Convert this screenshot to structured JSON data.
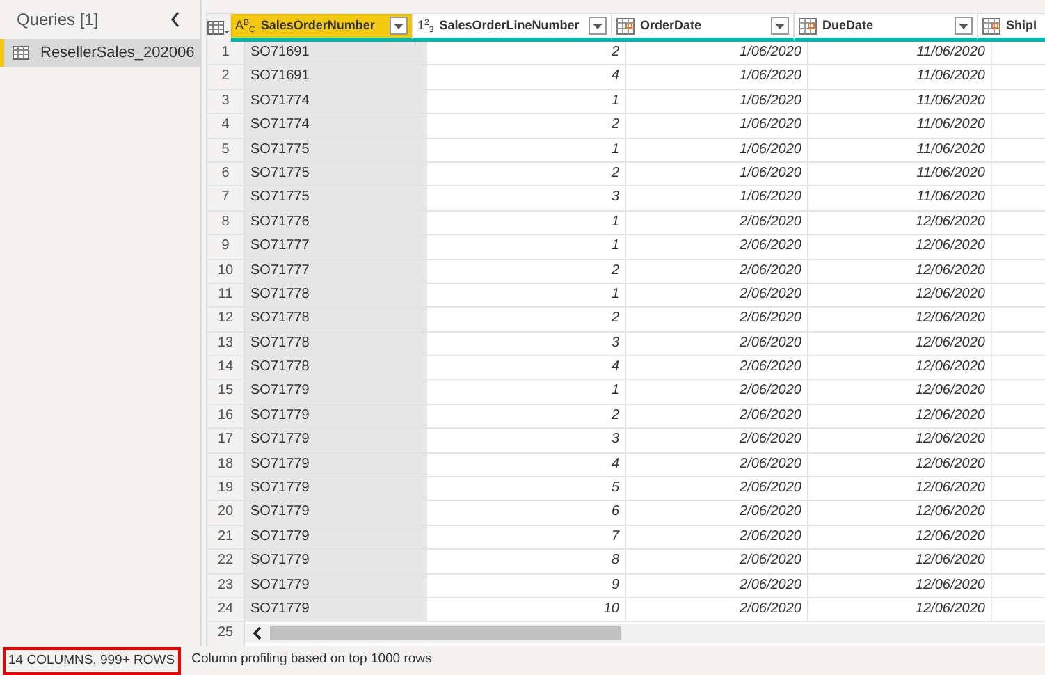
{
  "queries_pane": {
    "title": "Queries [1]",
    "items": [
      {
        "label": "ResellerSales_202006",
        "selected": true
      }
    ]
  },
  "table": {
    "columns": [
      {
        "label": "SalesOrderNumber",
        "kind": "text",
        "type_label": "A$^{B}$$_{C}$",
        "selected": true
      },
      {
        "label": "SalesOrderLineNumber",
        "kind": "number",
        "type_label": "1$^{2}$$_{3}$",
        "selected": false
      },
      {
        "label": "OrderDate",
        "kind": "date",
        "selected": false
      },
      {
        "label": "DueDate",
        "kind": "date",
        "selected": false
      },
      {
        "label": "ShipI",
        "kind": "date",
        "selected": false
      }
    ],
    "rows": [
      {
        "number": "1",
        "cells": [
          "SO71691",
          "2",
          "1/06/2020",
          "11/06/2020"
        ]
      },
      {
        "number": "2",
        "cells": [
          "SO71691",
          "4",
          "1/06/2020",
          "11/06/2020"
        ]
      },
      {
        "number": "3",
        "cells": [
          "SO71774",
          "1",
          "1/06/2020",
          "11/06/2020"
        ]
      },
      {
        "number": "4",
        "cells": [
          "SO71774",
          "2",
          "1/06/2020",
          "11/06/2020"
        ]
      },
      {
        "number": "5",
        "cells": [
          "SO71775",
          "1",
          "1/06/2020",
          "11/06/2020"
        ]
      },
      {
        "number": "6",
        "cells": [
          "SO71775",
          "2",
          "1/06/2020",
          "11/06/2020"
        ]
      },
      {
        "number": "7",
        "cells": [
          "SO71775",
          "3",
          "1/06/2020",
          "11/06/2020"
        ]
      },
      {
        "number": "8",
        "cells": [
          "SO71776",
          "1",
          "2/06/2020",
          "12/06/2020"
        ]
      },
      {
        "number": "9",
        "cells": [
          "SO71777",
          "1",
          "2/06/2020",
          "12/06/2020"
        ]
      },
      {
        "number": "10",
        "cells": [
          "SO71777",
          "2",
          "2/06/2020",
          "12/06/2020"
        ]
      },
      {
        "number": "11",
        "cells": [
          "SO71778",
          "1",
          "2/06/2020",
          "12/06/2020"
        ]
      },
      {
        "number": "12",
        "cells": [
          "SO71778",
          "2",
          "2/06/2020",
          "12/06/2020"
        ]
      },
      {
        "number": "13",
        "cells": [
          "SO71778",
          "3",
          "2/06/2020",
          "12/06/2020"
        ]
      },
      {
        "number": "14",
        "cells": [
          "SO71778",
          "4",
          "2/06/2020",
          "12/06/2020"
        ]
      },
      {
        "number": "15",
        "cells": [
          "SO71779",
          "1",
          "2/06/2020",
          "12/06/2020"
        ]
      },
      {
        "number": "16",
        "cells": [
          "SO71779",
          "2",
          "2/06/2020",
          "12/06/2020"
        ]
      },
      {
        "number": "17",
        "cells": [
          "SO71779",
          "3",
          "2/06/2020",
          "12/06/2020"
        ]
      },
      {
        "number": "18",
        "cells": [
          "SO71779",
          "4",
          "2/06/2020",
          "12/06/2020"
        ]
      },
      {
        "number": "19",
        "cells": [
          "SO71779",
          "5",
          "2/06/2020",
          "12/06/2020"
        ]
      },
      {
        "number": "20",
        "cells": [
          "SO71779",
          "6",
          "2/06/2020",
          "12/06/2020"
        ]
      },
      {
        "number": "21",
        "cells": [
          "SO71779",
          "7",
          "2/06/2020",
          "12/06/2020"
        ]
      },
      {
        "number": "22",
        "cells": [
          "SO71779",
          "8",
          "2/06/2020",
          "12/06/2020"
        ]
      },
      {
        "number": "23",
        "cells": [
          "SO71779",
          "9",
          "2/06/2020",
          "12/06/2020"
        ]
      },
      {
        "number": "24",
        "cells": [
          "SO71779",
          "10",
          "2/06/2020",
          "12/06/2020"
        ]
      },
      {
        "number": "25",
        "cells": []
      }
    ]
  },
  "status_bar": {
    "summary": "14 COLUMNS, 999+ ROWS",
    "note": "Column profiling based on top 1000 rows"
  }
}
